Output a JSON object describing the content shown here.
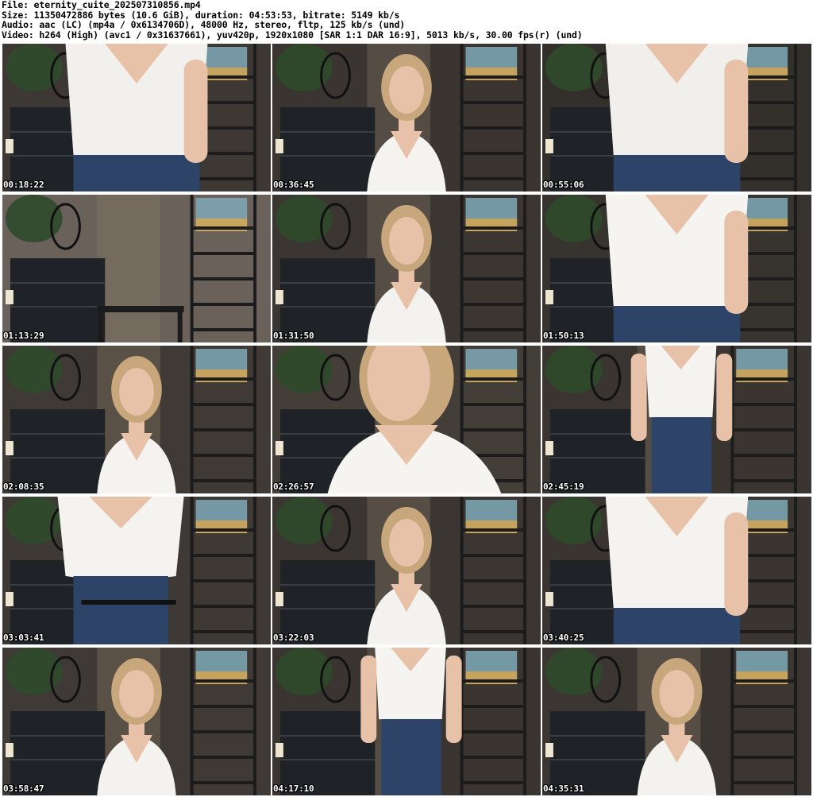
{
  "header": {
    "line1": "File: eternity_cuite_202507310856.mp4",
    "line2": "Size: 11350472886 bytes (10.6 GiB), duration: 04:53:53, bitrate: 5149 kb/s",
    "line3": "Audio: aac (LC) (mp4a / 0x6134706D), 48000 Hz, stereo, fltp, 125 kb/s (und)",
    "line4": "Video: h264 (High) (avc1 / 0x31637661), yuv420p, 1920x1080 [SAR 1:1 DAR 16:9], 5013 kb/s, 30.00 fps(r) (und)"
  },
  "thumbnails": [
    {
      "timestamp": "00:18:22",
      "scene": "torso-close",
      "wall": "#3d3833",
      "shirt": "#f2f0ec"
    },
    {
      "timestamp": "00:36:45",
      "scene": "portrait-smile",
      "wall": "#3a3531",
      "shirt": "#f4f3ef"
    },
    {
      "timestamp": "00:55:06",
      "scene": "chest-close",
      "wall": "#33302c",
      "shirt": "#f1efeb"
    },
    {
      "timestamp": "01:13:29",
      "scene": "empty-room",
      "wall": "#6a625a",
      "shirt": "#f2f0ec"
    },
    {
      "timestamp": "01:31:50",
      "scene": "portrait",
      "wall": "#3b3632",
      "shirt": "#f3f2ee"
    },
    {
      "timestamp": "01:50:13",
      "scene": "torso-arm",
      "wall": "#37332f",
      "shirt": "#f5f4f0"
    },
    {
      "timestamp": "02:08:35",
      "scene": "portrait-smile",
      "wall": "#3f3a35",
      "shirt": "#f4f3ef"
    },
    {
      "timestamp": "02:26:57",
      "scene": "portrait-close",
      "wall": "#443e38",
      "shirt": "#f5f4f0"
    },
    {
      "timestamp": "02:45:19",
      "scene": "standing",
      "wall": "#3a3531",
      "shirt": "#f4f3ef"
    },
    {
      "timestamp": "03:03:41",
      "scene": "torso-chair",
      "wall": "#3e3934",
      "shirt": "#f4f3ef"
    },
    {
      "timestamp": "03:22:03",
      "scene": "portrait",
      "wall": "#3b3632",
      "shirt": "#f3f2ee"
    },
    {
      "timestamp": "03:40:25",
      "scene": "torso-wide",
      "wall": "#3a3531",
      "shirt": "#f4f3ef"
    },
    {
      "timestamp": "03:58:47",
      "scene": "portrait",
      "wall": "#3f3a35",
      "shirt": "#f3f2ee"
    },
    {
      "timestamp": "04:17:10",
      "scene": "standing-crop",
      "wall": "#3a3531",
      "shirt": "#f5f4f0"
    },
    {
      "timestamp": "04:35:31",
      "scene": "portrait-down",
      "wall": "#3b3632",
      "shirt": "#f3f2ee"
    }
  ],
  "colors": {
    "background": "#ffffff",
    "text": "#000000",
    "timestamp_text": "#ffffff",
    "timestamp_outline": "#000000",
    "hair": "#c9a77c",
    "skin": "#e8c2a8",
    "jeans": "#2d4468",
    "plant": "#2f4a2a",
    "shelf": "#1c1c1c",
    "poster": "#7fa9b8"
  }
}
